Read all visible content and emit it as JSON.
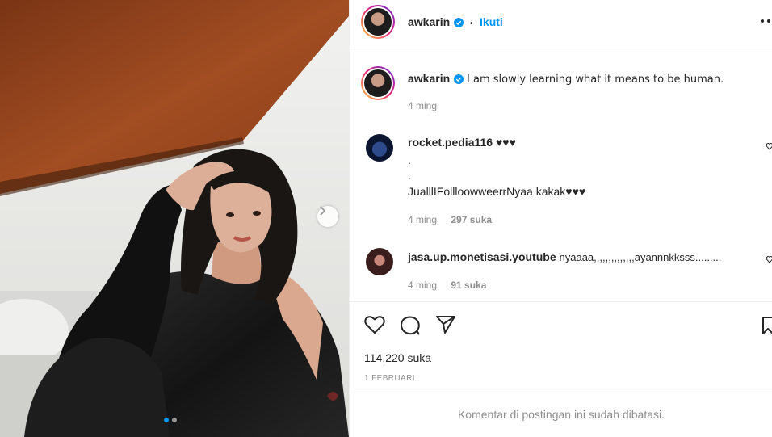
{
  "post": {
    "username": "awkarin",
    "follow_label": "Ikuti",
    "separator": "•",
    "caption": "I am slowly learning what it means to be human.",
    "caption_age": "4 ming",
    "likes": "114,220 suka",
    "date": "1 FEBRUARI",
    "comments_disabled": "Komentar di postingan ini sudah dibatasi.",
    "carousel": {
      "slide_count": 2,
      "active_index": 0
    }
  },
  "comments": [
    {
      "username": "rocket.pedia116",
      "lines": [
        "♥♥♥",
        ".",
        ".",
        "JualllIFollloowweerrNyaa kakak♥♥♥"
      ],
      "age": "4 ming",
      "likes": "297 suka"
    },
    {
      "username": "jasa.up.monetisasi.youtube",
      "text": "nyaaaa,,,,,,,,,,,,,,ayannnkksss.........",
      "age": "4 ming",
      "likes": "91 suka"
    }
  ],
  "icons": {
    "verified": "verified-badge-icon",
    "like": "heart-icon",
    "comment": "comment-icon",
    "share": "paper-plane-icon",
    "save": "bookmark-icon",
    "more": "more-options-icon",
    "next": "chevron-right-icon"
  },
  "colors": {
    "accent": "#0095f6",
    "text": "#262626",
    "muted": "#8e8e8e",
    "divider": "#efefef"
  }
}
